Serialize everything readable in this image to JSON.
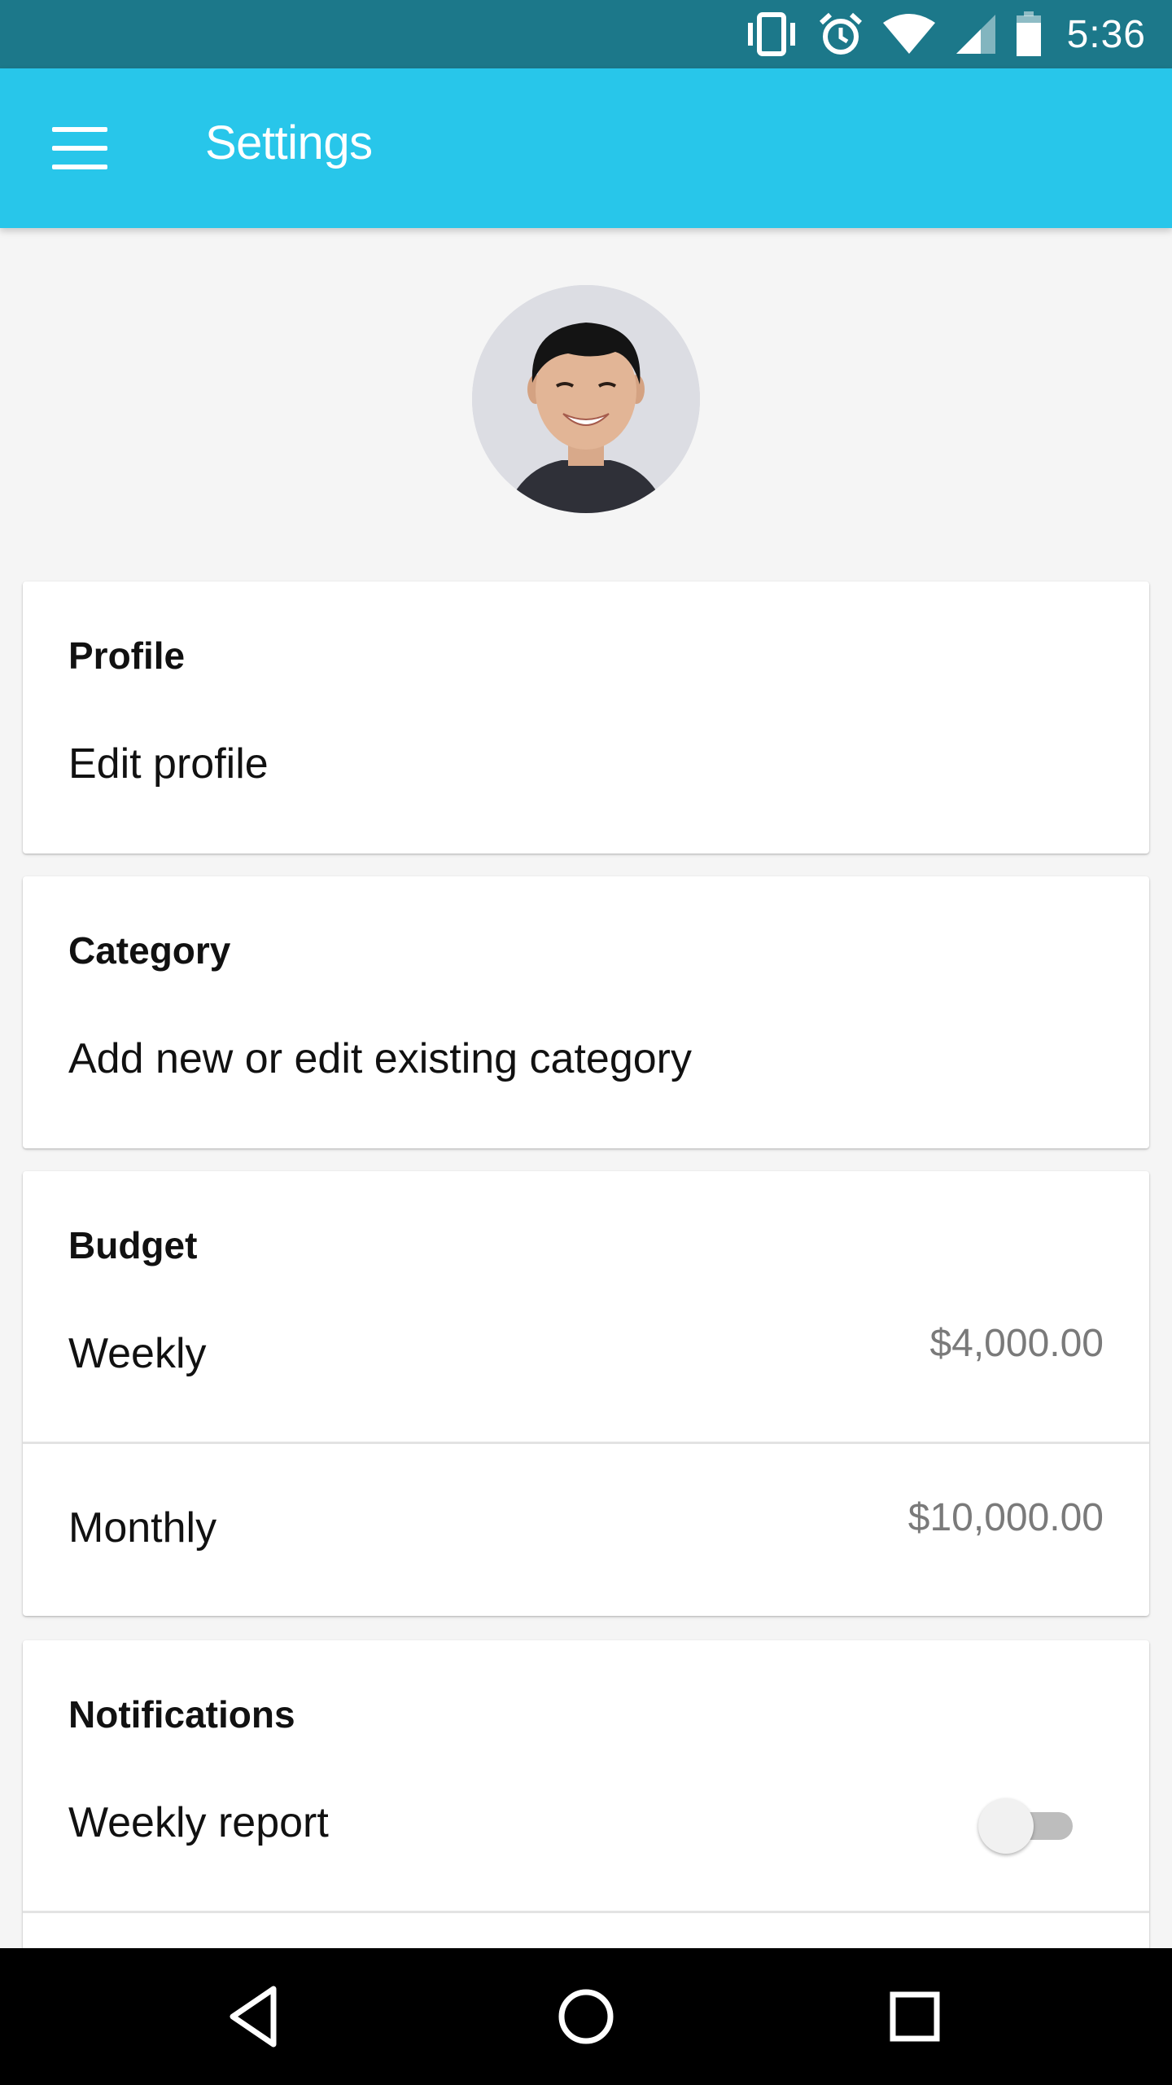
{
  "status_bar": {
    "time": "5:36",
    "icons": [
      "vibrate-icon",
      "alarm-icon",
      "wifi-icon",
      "cellular-signal-icon",
      "battery-icon"
    ]
  },
  "app_bar": {
    "title": "Settings",
    "menu_icon": "hamburger-menu-icon",
    "color": "#28c6ea"
  },
  "profile_card": {
    "title": "Profile",
    "item": "Edit profile"
  },
  "category_card": {
    "title": "Category",
    "item": "Add new or edit existing category"
  },
  "budget_card": {
    "title": "Budget",
    "weekly_label": "Weekly",
    "weekly_value": "$4,000.00",
    "monthly_label": "Monthly",
    "monthly_value": "$10,000.00"
  },
  "notifications_card": {
    "title": "Notifications",
    "weekly_report_label": "Weekly report",
    "weekly_report_enabled": false
  },
  "nav_bar": {
    "icons": [
      "back-icon",
      "home-icon",
      "recents-icon"
    ]
  }
}
